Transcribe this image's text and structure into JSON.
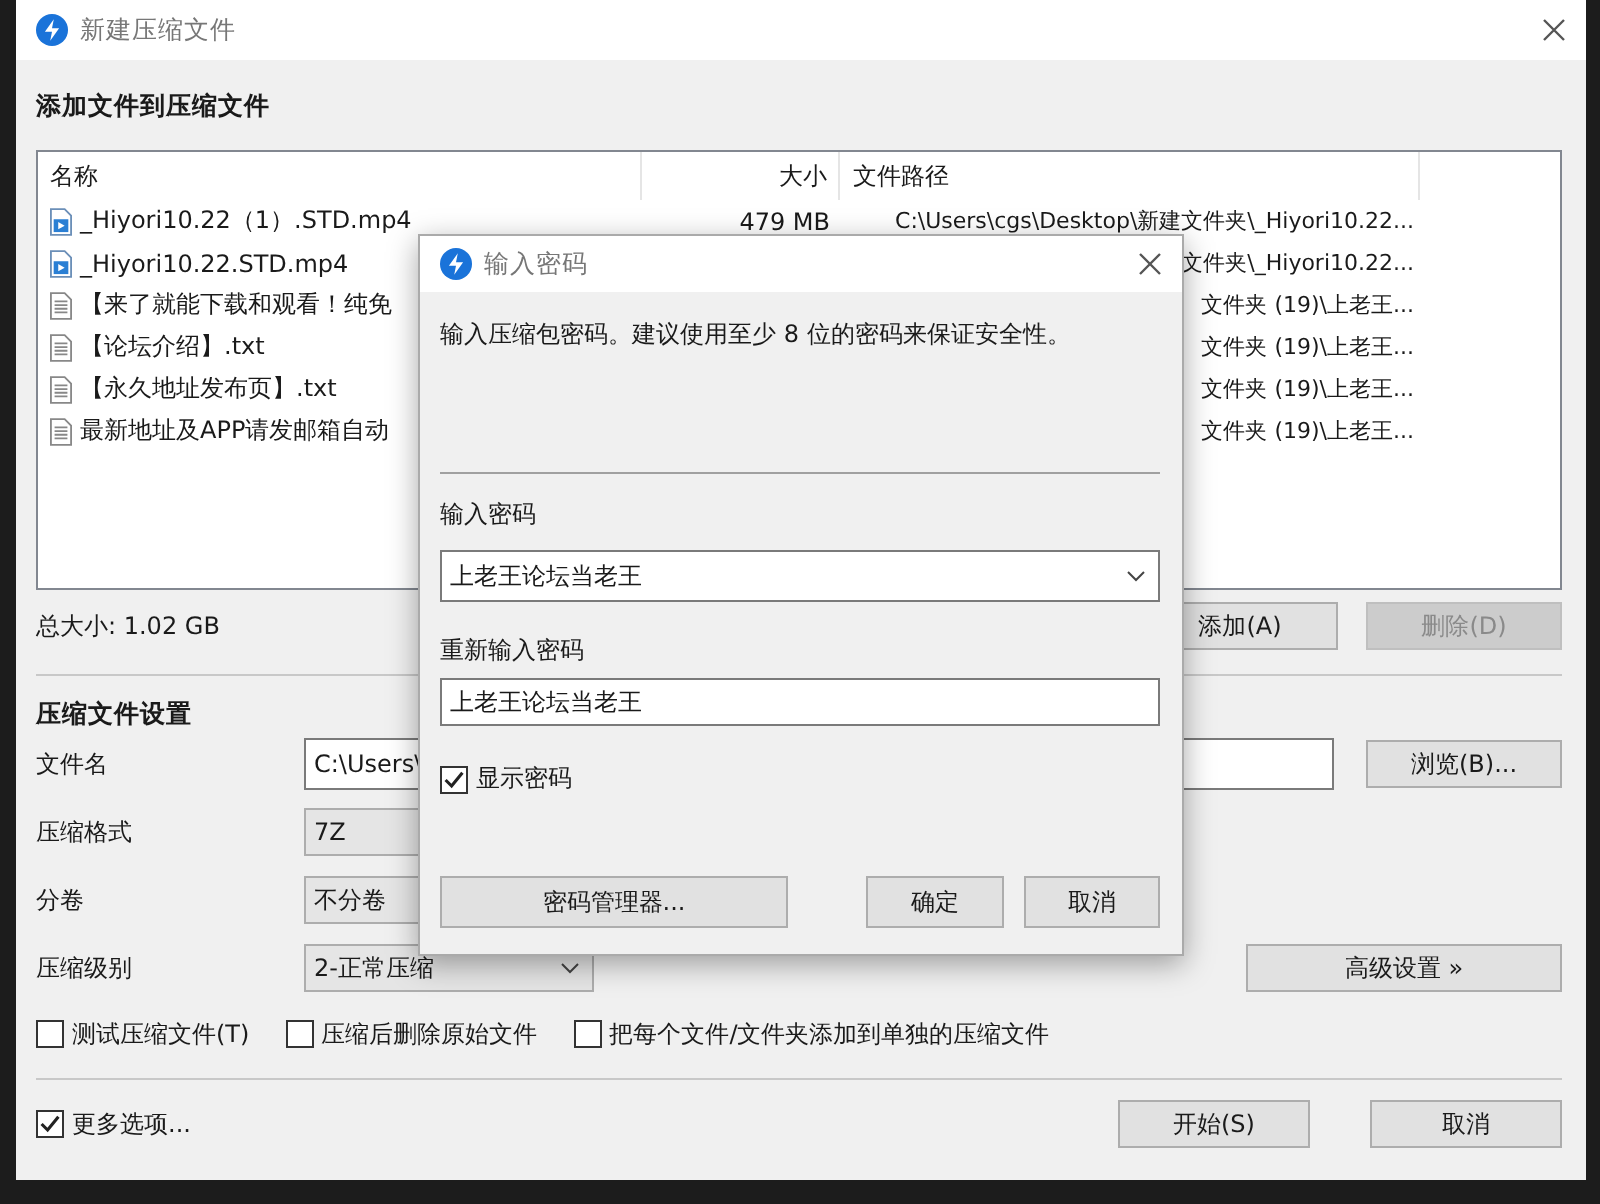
{
  "window": {
    "title": "新建压缩文件"
  },
  "files": {
    "title": "添加文件到压缩文件",
    "columns": [
      "名称",
      "大小",
      "文件路径"
    ],
    "rows": [
      {
        "kind": "video",
        "name": "_Hiyori10.22（1）.STD.mp4",
        "size": "479 MB",
        "path": "C:\\Users\\cgs\\Desktop\\新建文件夹\\_Hiyori10.22..."
      },
      {
        "kind": "video",
        "name": "_Hiyori10.22.STD.mp4",
        "path": "文件夹\\_Hiyori10.22..."
      },
      {
        "kind": "text",
        "name": "【来了就能下载和观看！纯免",
        "path": "文件夹 (19)\\上老王..."
      },
      {
        "kind": "text",
        "name": "【论坛介绍】.txt",
        "path": "文件夹 (19)\\上老王..."
      },
      {
        "kind": "text",
        "name": "【永久地址发布页】.txt",
        "path": "文件夹 (19)\\上老王..."
      },
      {
        "kind": "text",
        "name": "最新地址及APP请发邮箱自动",
        "path": "文件夹 (19)\\上老王..."
      }
    ],
    "total": "总大小: 1.02 GB",
    "buttons": [
      {
        "label": "添加(A)",
        "disabled": false
      },
      {
        "label": "删除(D)",
        "disabled": true
      }
    ]
  },
  "settings": {
    "title": "压缩文件设置",
    "fields": [
      {
        "kind": "text",
        "label": "文件名",
        "value": "C:\\Users\\",
        "button": "浏览(B)..."
      },
      {
        "kind": "select",
        "label": "压缩格式",
        "value": "7Z"
      },
      {
        "kind": "select",
        "label": "分卷",
        "value": "不分卷"
      },
      {
        "kind": "select",
        "label": "压缩级别",
        "value": "2-正常压缩",
        "button": "高级设置 »"
      }
    ],
    "options": [
      {
        "label": "测试压缩文件(T)",
        "checked": false
      },
      {
        "label": "压缩后删除原始文件",
        "checked": false
      },
      {
        "label": "把每个文件/文件夹添加到单独的压缩文件",
        "checked": false
      }
    ]
  },
  "footer": {
    "more": {
      "label": "更多选项...",
      "checked": true
    },
    "buttons": [
      "开始(S)",
      "取消"
    ]
  },
  "dialog": {
    "title": "输入密码",
    "message": "输入压缩包密码。建议使用至少 8 位的密码来保证安全性。",
    "password_label": "输入密码",
    "password": "上老王论坛当老王",
    "confirm_label": "重新输入密码",
    "confirm": "上老王论坛当老王",
    "show_password": {
      "label": "显示密码",
      "checked": true
    },
    "buttons": [
      "密码管理器...",
      "确定",
      "取消"
    ]
  }
}
